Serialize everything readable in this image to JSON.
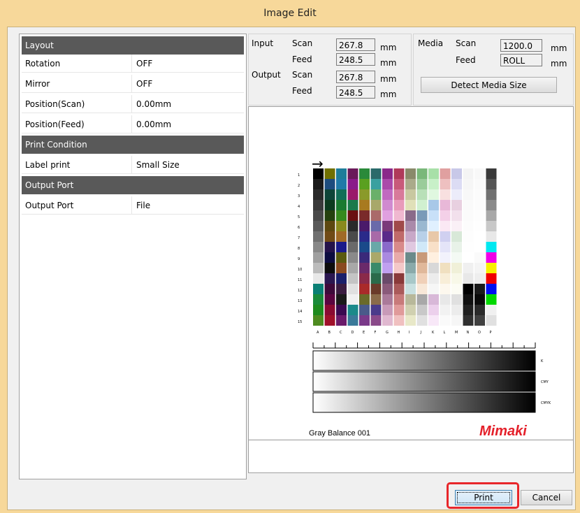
{
  "window": {
    "title": "Image Edit"
  },
  "props": {
    "sections": [
      {
        "title": "Layout"
      },
      {
        "title": "Print Condition"
      },
      {
        "title": "Output Port"
      }
    ],
    "rows": [
      {
        "label": "Rotation",
        "value": "OFF"
      },
      {
        "label": "Mirror",
        "value": "OFF"
      },
      {
        "label": "Position(Scan)",
        "value": "0.00mm"
      },
      {
        "label": "Position(Feed)",
        "value": "0.00mm"
      },
      {
        "label": "Label print",
        "value": "Small Size"
      },
      {
        "label": "Output Port",
        "value": "File"
      }
    ]
  },
  "size": {
    "input_label": "Input",
    "output_label": "Output",
    "scan_label": "Scan",
    "feed_label": "Feed",
    "unit": "mm",
    "input_scan": "267.8",
    "input_feed": "248.5",
    "output_scan": "267.8",
    "output_feed": "248.5"
  },
  "media": {
    "label": "Media",
    "scan_label": "Scan",
    "feed_label": "Feed",
    "scan_value": "1200.0",
    "feed_value": "ROLL",
    "unit": "mm",
    "detect_button": "Detect Media Size"
  },
  "preview": {
    "caption": "Gray Balance 001",
    "brand": "Mimaki",
    "arrow": "→",
    "row_numbers": [
      "1",
      "2",
      "3",
      "4",
      "5",
      "6",
      "7",
      "8",
      "9",
      "10",
      "11",
      "12",
      "13",
      "14",
      "15"
    ],
    "col_letters": [
      "A",
      "B",
      "C",
      "D",
      "E",
      "F",
      "G",
      "H",
      "I",
      "J",
      "K",
      "L",
      "M",
      "N",
      "O",
      "P"
    ],
    "strip_labels": [
      "K",
      "CMY",
      "CMYK"
    ]
  },
  "buttons": {
    "print": "Print",
    "cancel": "Cancel"
  },
  "colors": {
    "section_bg": "#595959",
    "highlight": "#e8262a",
    "brand": "#e4202a"
  }
}
